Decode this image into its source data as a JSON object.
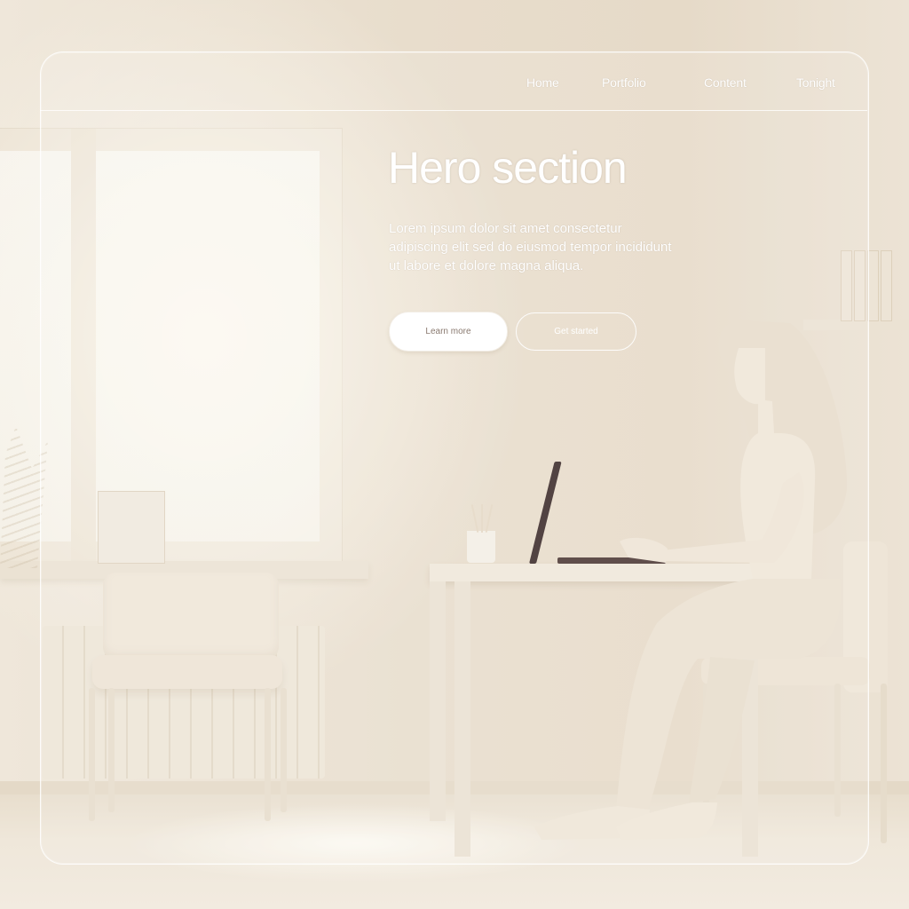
{
  "nav": {
    "items": [
      {
        "label": "Home"
      },
      {
        "label": "Portfolio"
      },
      {
        "label": "Content"
      },
      {
        "label": "Tonight"
      }
    ]
  },
  "hero": {
    "title": "Hero section",
    "description": "Lorem ipsum dolor sit amet consectetur adipiscing elit sed do eiusmod tempor incididunt ut labore et dolore magna aliqua.",
    "primary_button": "Learn more",
    "secondary_button": "Get started"
  },
  "colors": {
    "background": "#e9dfd0",
    "glass_border": "#ffffff",
    "text": "#ffffff",
    "laptop": "#3b2a28"
  }
}
